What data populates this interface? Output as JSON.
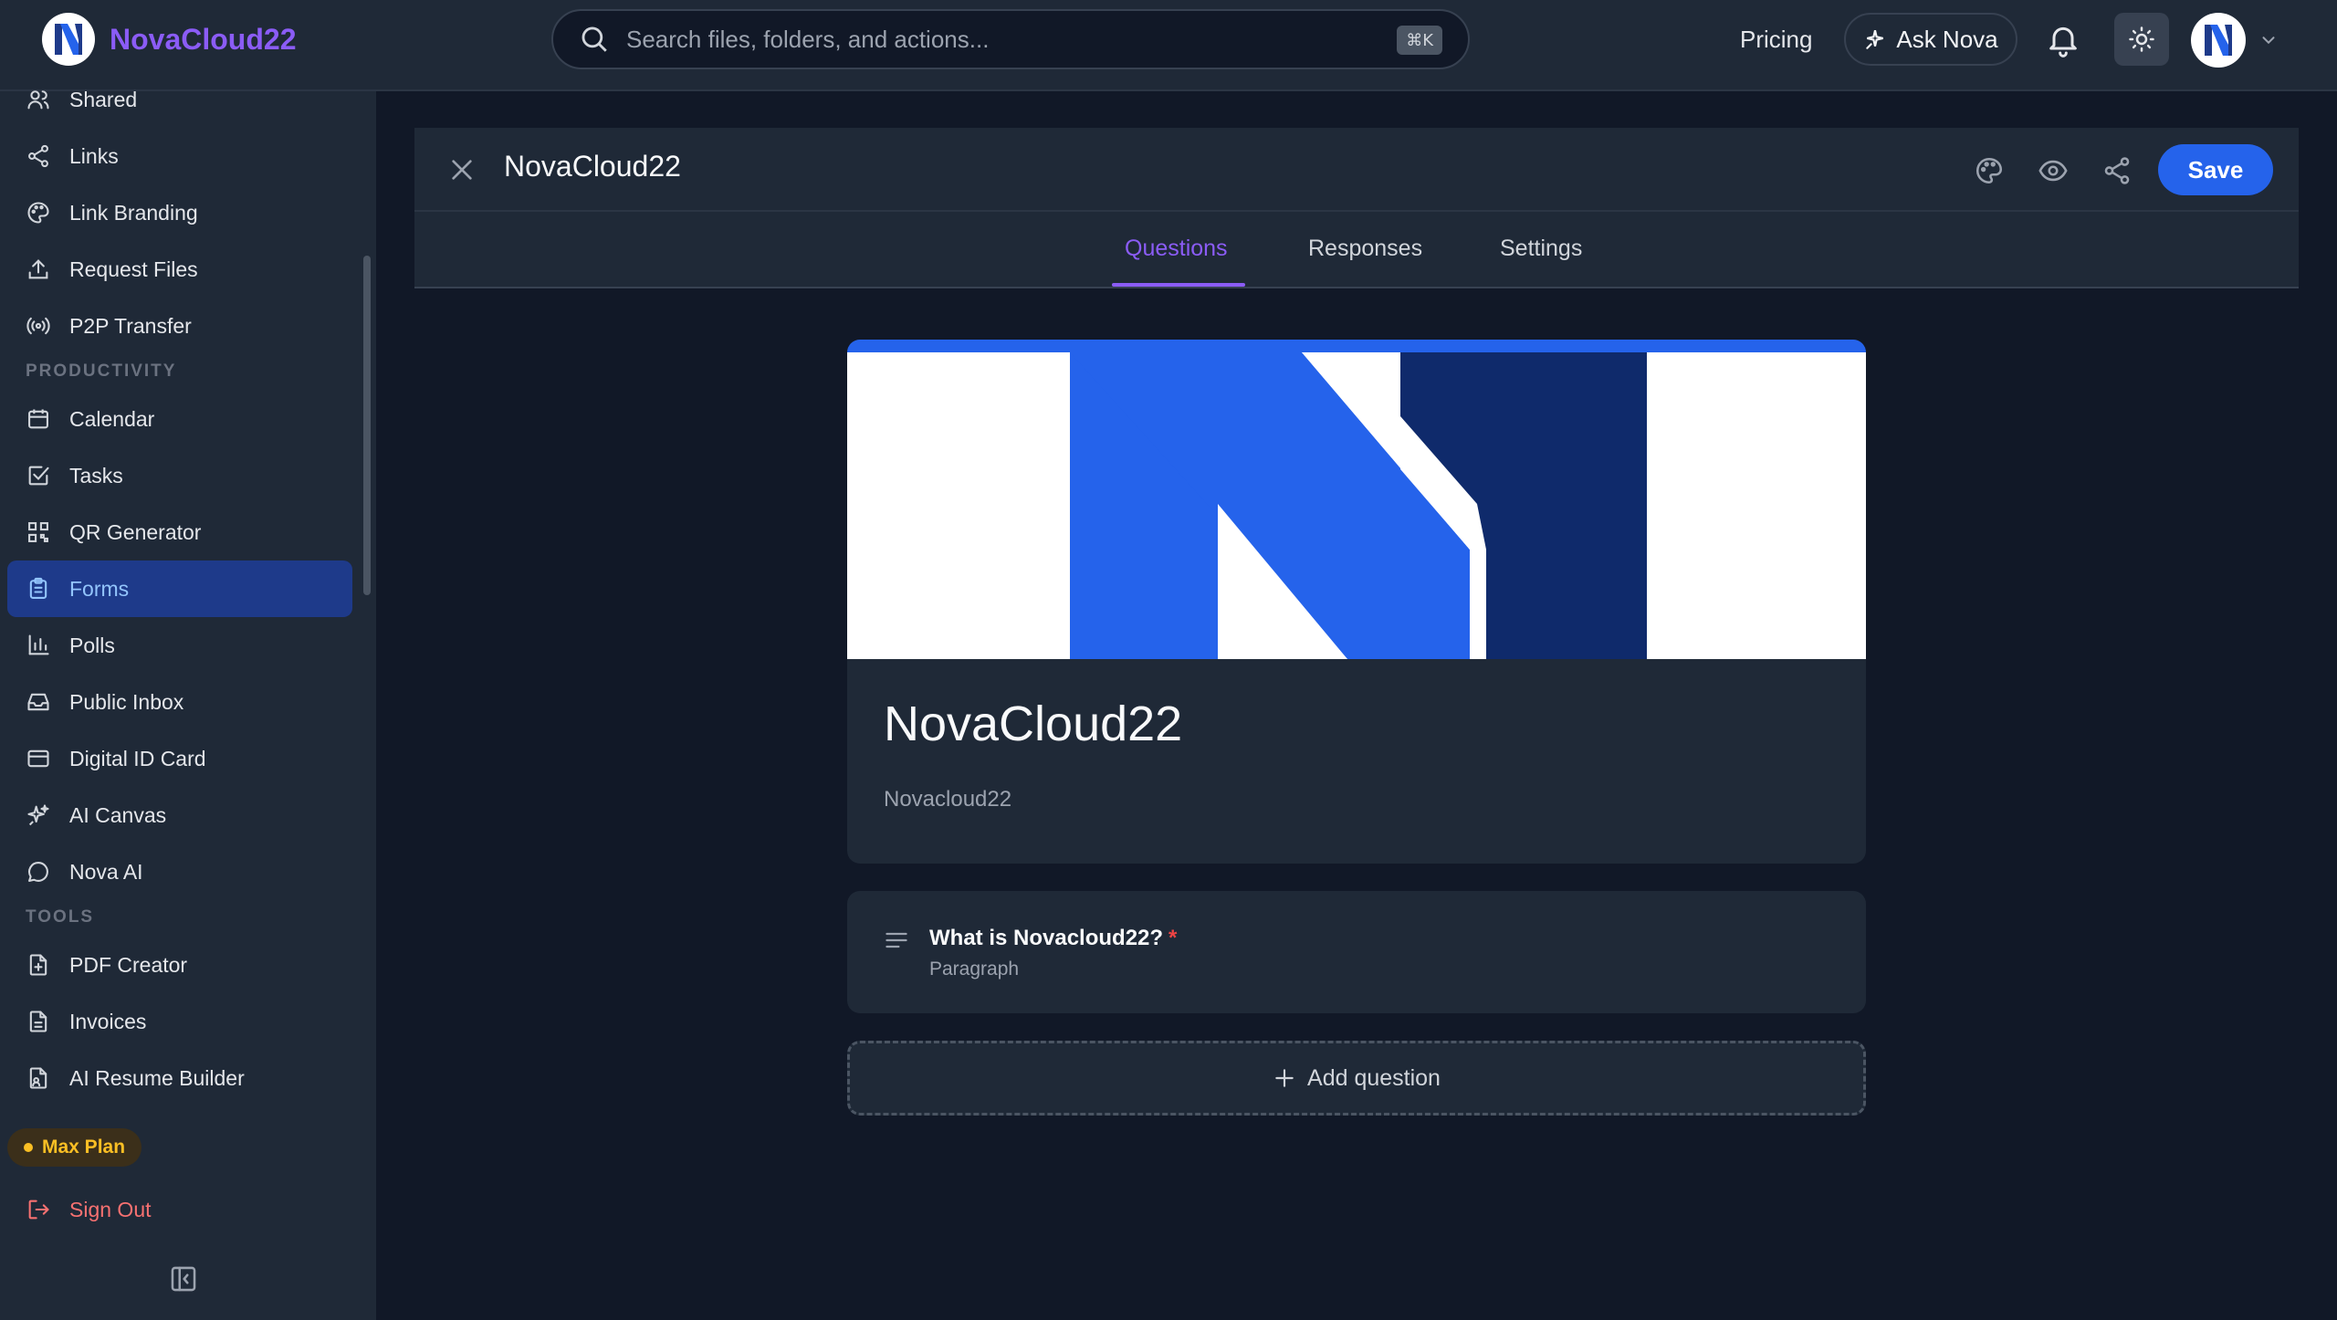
{
  "app": {
    "name": "NovaCloud22"
  },
  "search": {
    "placeholder": "Search files, folders, and actions...",
    "shortcut": "⌘K"
  },
  "header": {
    "pricing": "Pricing",
    "ask_nova": "Ask Nova"
  },
  "sidebar": {
    "items_top": [
      {
        "label": "Shared",
        "icon": "users-icon"
      },
      {
        "label": "Links",
        "icon": "share-nodes-icon"
      },
      {
        "label": "Link Branding",
        "icon": "palette-icon"
      },
      {
        "label": "Request Files",
        "icon": "upload-icon"
      },
      {
        "label": "P2P Transfer",
        "icon": "broadcast-icon"
      }
    ],
    "section_productivity": "PRODUCTIVITY",
    "items_productivity": [
      {
        "label": "Calendar",
        "icon": "calendar-icon"
      },
      {
        "label": "Tasks",
        "icon": "checkbox-icon"
      },
      {
        "label": "QR Generator",
        "icon": "qr-code-icon"
      },
      {
        "label": "Forms",
        "icon": "clipboard-icon",
        "active": true
      },
      {
        "label": "Polls",
        "icon": "bar-chart-icon"
      },
      {
        "label": "Public Inbox",
        "icon": "inbox-icon"
      },
      {
        "label": "Digital ID Card",
        "icon": "id-card-icon"
      },
      {
        "label": "AI Canvas",
        "icon": "sparkles-icon"
      },
      {
        "label": "Nova AI",
        "icon": "chat-bubble-icon"
      }
    ],
    "section_tools": "TOOLS",
    "items_tools": [
      {
        "label": "PDF Creator",
        "icon": "file-plus-icon"
      },
      {
        "label": "Invoices",
        "icon": "file-text-icon"
      },
      {
        "label": "AI Resume Builder",
        "icon": "file-user-icon"
      }
    ],
    "plan": "Max Plan",
    "sign_out": "Sign Out"
  },
  "form_editor": {
    "title": "NovaCloud22",
    "save_label": "Save",
    "tabs": [
      {
        "label": "Questions",
        "active": true
      },
      {
        "label": "Responses"
      },
      {
        "label": "Settings"
      }
    ]
  },
  "form": {
    "title": "NovaCloud22",
    "description": "Novacloud22",
    "questions": [
      {
        "title": "What is Novacloud22?",
        "required_mark": "*",
        "type": "Paragraph"
      }
    ],
    "add_question_label": "Add question"
  },
  "colors": {
    "accent_purple": "#8b5cf6",
    "primary_blue": "#2563eb",
    "sidebar_bg": "#1f2937",
    "page_bg": "#111827",
    "active_item_bg": "#1e3a8a",
    "sign_out": "#f87171",
    "plan_badge": "#fbbf24"
  }
}
